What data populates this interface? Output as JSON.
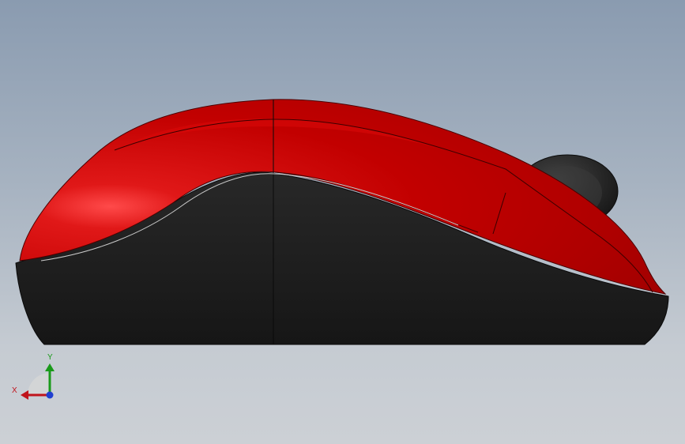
{
  "viewport": {
    "model": {
      "upper_shell_color": "#c40000",
      "base_color": "#1f1f1f",
      "wheel_color": "#2a2a2a"
    },
    "triad": {
      "x_label": "X",
      "y_label": "Y",
      "x_color": "#c0141c",
      "y_color": "#1a9a1a",
      "z_color": "#1f3fd0"
    }
  }
}
